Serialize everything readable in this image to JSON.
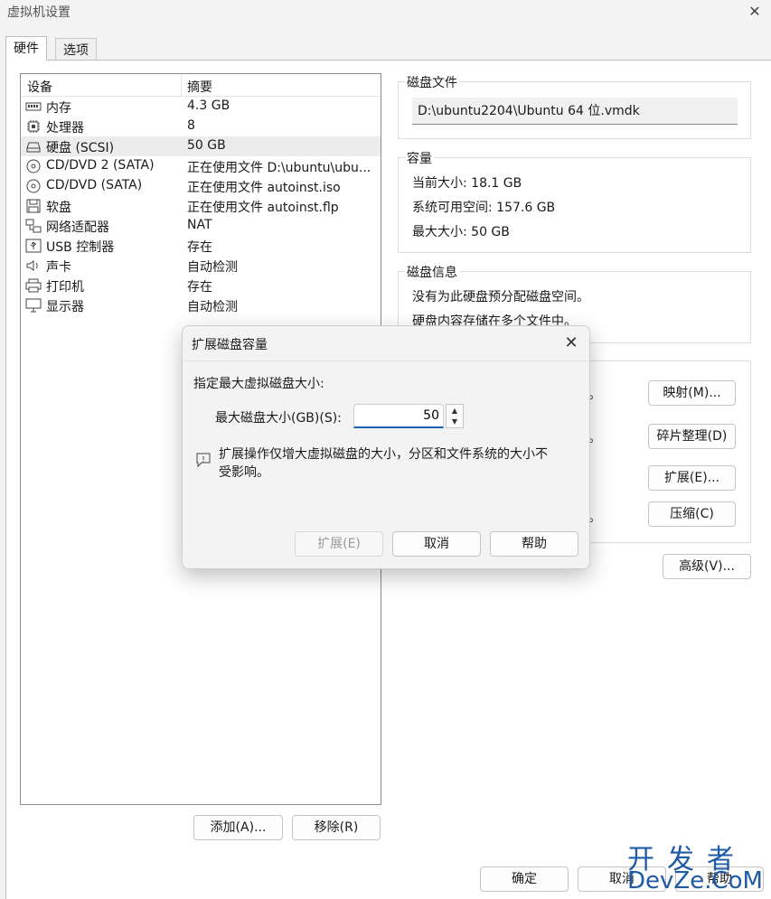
{
  "window": {
    "title": "虚拟机设置"
  },
  "tabs": [
    {
      "label": "硬件",
      "active": true
    },
    {
      "label": "选项",
      "active": false
    }
  ],
  "device_list": {
    "columns": [
      "设备",
      "摘要"
    ],
    "rows": [
      {
        "name": "内存",
        "summary": "4.3 GB",
        "icon": "memory-icon"
      },
      {
        "name": "处理器",
        "summary": "8",
        "icon": "processor-icon"
      },
      {
        "name": "硬盘 (SCSI)",
        "summary": "50 GB",
        "icon": "hard-disk-icon",
        "selected": true
      },
      {
        "name": "CD/DVD 2 (SATA)",
        "summary": "正在使用文件 D:\\ubuntu\\ubu...",
        "icon": "cd-dvd-icon"
      },
      {
        "name": "CD/DVD (SATA)",
        "summary": "正在使用文件 autoinst.iso",
        "icon": "cd-dvd-icon"
      },
      {
        "name": "软盘",
        "summary": "正在使用文件 autoinst.flp",
        "icon": "floppy-icon"
      },
      {
        "name": "网络适配器",
        "summary": "NAT",
        "icon": "network-adapter-icon"
      },
      {
        "name": "USB 控制器",
        "summary": "存在",
        "icon": "usb-icon"
      },
      {
        "name": "声卡",
        "summary": "自动检测",
        "icon": "speaker-icon"
      },
      {
        "name": "打印机",
        "summary": "存在",
        "icon": "printer-icon"
      },
      {
        "name": "显示器",
        "summary": "自动检测",
        "icon": "monitor-icon"
      }
    ],
    "add_button": "添加(A)...",
    "remove_button": "移除(R)"
  },
  "disk_file": {
    "title": "磁盘文件",
    "path": "D:\\ubuntu2204\\Ubuntu 64 位.vmdk"
  },
  "capacity": {
    "title": "容量",
    "current": "当前大小: 18.1 GB",
    "available": "系统可用空间: 157.6 GB",
    "max": "最大大小: 50 GB"
  },
  "disk_info": {
    "title": "磁盘信息",
    "line1": "没有为此硬盘预分配磁盘空间。",
    "line2": "硬盘内容存储在多个文件中。"
  },
  "utilities": {
    "dot": "。",
    "map_button": "映射(M)...",
    "defrag_button": "碎片整理(D)",
    "expand_button": "扩展(E)...",
    "compact_button": "压缩(C)"
  },
  "advanced_button": "高级(V)...",
  "footer": {
    "ok_button": "确定",
    "cancel_button": "取消",
    "help_button": "帮助"
  },
  "expand_dialog": {
    "title": "扩展磁盘容量",
    "instruction": "指定最大虚拟磁盘大小:",
    "size_label": "最大磁盘大小(GB)(S):",
    "size_value": "50",
    "note_line1": "扩展操作仅增大虚拟磁盘的大小，分区和文件系统的大小不",
    "note_line2": "受影响。",
    "expand_button": "扩展(E)",
    "cancel_button": "取消",
    "help_button": "帮助"
  },
  "watermark": {
    "line1": "开发者",
    "line2": "DevZe.CoM"
  },
  "colors": {
    "accent": "#1a5fb4",
    "watermark": "#1f5aa6",
    "selected_row": "#ececec"
  }
}
